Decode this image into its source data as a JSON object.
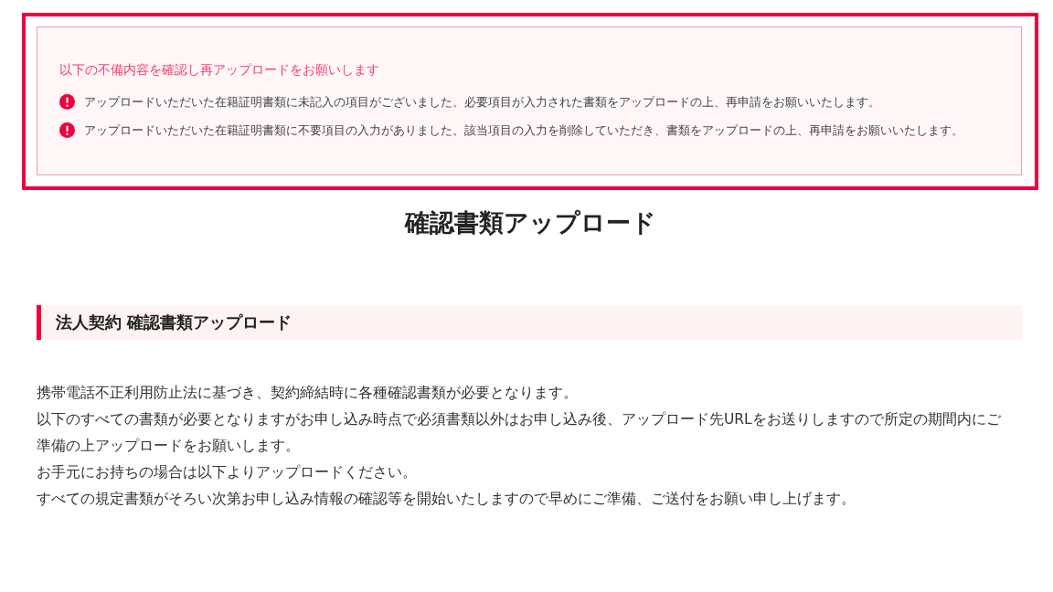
{
  "alert": {
    "title": "以下の不備内容を確認し再アップロードをお願いします",
    "items": [
      {
        "text": "アップロードいただいた在籍証明書類に未記入の項目がございました。必要項目が入力された書類をアップロードの上、再申請をお願いいたします。"
      },
      {
        "text": "アップロードいただいた在籍証明書類に不要項目の入力がありました。該当項目の入力を削除していただき、書類をアップロードの上、再申請をお願いいたします。"
      }
    ]
  },
  "page_title": "確認書類アップロード",
  "section": {
    "heading": "法人契約 確認書類アップロード",
    "lines": [
      "携帯電話不正利用防止法に基づき、契約締結時に各種確認書類が必要となります。",
      "以下のすべての書類が必要となりますがお申し込み時点で必須書類以外はお申し込み後、アップロード先URLをお送りしますので所定の期間内にご準備の上アップロードをお願いします。",
      "お手元にお持ちの場合は以下よりアップロードください。",
      "すべての規定書類がそろい次第お申し込み情報の確認等を開始いたしますので早めにご準備、ご送付をお願い申し上げます。"
    ]
  }
}
